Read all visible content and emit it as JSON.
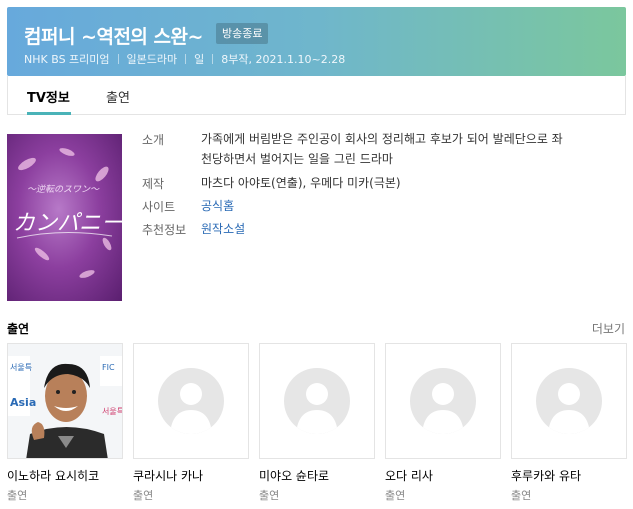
{
  "header": {
    "title": "컴퍼니 ~역전의 스완~",
    "badge": "방송종료",
    "meta": [
      "NHK BS 프리미엄",
      "일본드라마",
      "일",
      "8부작, 2021.1.10~2.28"
    ]
  },
  "tabs": [
    {
      "label": "TV정보",
      "active": true
    },
    {
      "label": "출연",
      "active": false
    }
  ],
  "info": {
    "intro_label": "소개",
    "intro_line1": "가족에게 버림받은 주인공이 회사의 정리해고 후보가 되어 발레단으로 좌",
    "intro_line2": "천당하면서 벌어지는 일을 그린 드라마",
    "production_label": "제작",
    "production_value": "마츠다 아야토(연출), 우메다 미카(극본)",
    "site_label": "사이트",
    "site_value": "공식홈",
    "recommend_label": "추천정보",
    "recommend_value": "원작소설"
  },
  "poster": {
    "script_text": "カンパニー"
  },
  "cast_section": {
    "title": "출연",
    "more": "더보기",
    "members": [
      {
        "name": "이노하라 요시히코",
        "role": "출연",
        "has_photo": true
      },
      {
        "name": "쿠라시나 카나",
        "role": "출연",
        "has_photo": false
      },
      {
        "name": "미야오 슌타로",
        "role": "출연",
        "has_photo": false
      },
      {
        "name": "오다 리사",
        "role": "출연",
        "has_photo": false
      },
      {
        "name": "후루카와 유타",
        "role": "출연",
        "has_photo": false
      }
    ]
  },
  "colors": {
    "accent": "#4ab3b8",
    "link": "#2a6ab5",
    "header_start": "#67a9dc",
    "header_end": "#7bc79d"
  }
}
